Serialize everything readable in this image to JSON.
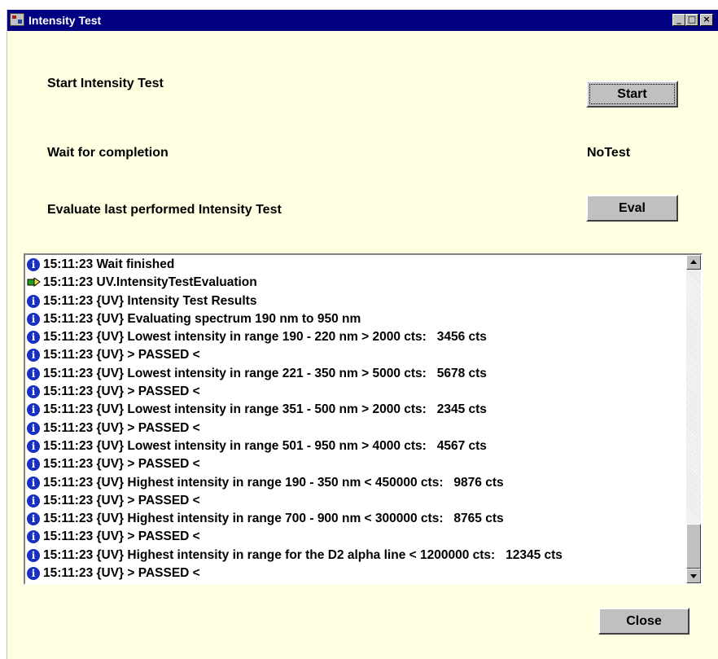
{
  "window": {
    "title": "Intensity Test"
  },
  "titlebar_buttons": {
    "minimize": "_",
    "maximize": "□",
    "close": "×"
  },
  "steps": {
    "start_label": "Start Intensity Test",
    "start_button": "Start",
    "wait_label": "Wait for completion",
    "wait_status": "NoTest",
    "eval_label": "Evaluate last performed Intensity Test",
    "eval_button": "Eval"
  },
  "log": [
    {
      "icon": "info-icon",
      "text": "15:11:23 Wait finished"
    },
    {
      "icon": "action-icon",
      "text": "15:11:23 UV.IntensityTestEvaluation"
    },
    {
      "icon": "info-icon",
      "text": "15:11:23 {UV} Intensity Test Results"
    },
    {
      "icon": "info-icon",
      "text": "15:11:23 {UV} Evaluating spectrum 190 nm to 950 nm"
    },
    {
      "icon": "info-icon",
      "text": "15:11:23 {UV} Lowest intensity in range 190 - 220 nm > 2000 cts:   3456 cts"
    },
    {
      "icon": "info-icon",
      "text": "15:11:23 {UV} > PASSED <"
    },
    {
      "icon": "info-icon",
      "text": "15:11:23 {UV} Lowest intensity in range 221 - 350 nm > 5000 cts:   5678 cts"
    },
    {
      "icon": "info-icon",
      "text": "15:11:23 {UV} > PASSED <"
    },
    {
      "icon": "info-icon",
      "text": "15:11:23 {UV} Lowest intensity in range 351 - 500 nm > 2000 cts:   2345 cts"
    },
    {
      "icon": "info-icon",
      "text": "15:11:23 {UV} > PASSED <"
    },
    {
      "icon": "info-icon",
      "text": "15:11:23 {UV} Lowest intensity in range 501 - 950 nm > 4000 cts:   4567 cts"
    },
    {
      "icon": "info-icon",
      "text": "15:11:23 {UV} > PASSED <"
    },
    {
      "icon": "info-icon",
      "text": "15:11:23 {UV} Highest intensity in range 190 - 350 nm < 450000 cts:   9876 cts"
    },
    {
      "icon": "info-icon",
      "text": "15:11:23 {UV} > PASSED <"
    },
    {
      "icon": "info-icon",
      "text": "15:11:23 {UV} Highest intensity in range 700 - 900 nm < 300000 cts:   8765 cts"
    },
    {
      "icon": "info-icon",
      "text": "15:11:23 {UV} > PASSED <"
    },
    {
      "icon": "info-icon",
      "text": "15:11:23 {UV} Highest intensity in range for the D2 alpha line < 1200000 cts:   12345 cts"
    },
    {
      "icon": "info-icon",
      "text": "15:11:23 {UV} > PASSED <"
    }
  ],
  "close_button": "Close",
  "colors": {
    "background": "#ffffe1",
    "titlebar": "#000080",
    "button_face": "#c0c0c0",
    "info_icon": "#1830c0"
  }
}
